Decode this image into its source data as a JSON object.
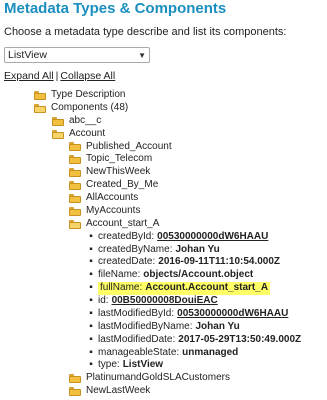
{
  "header": {
    "title": "Metadata Types & Components",
    "prompt": "Choose a metadata type describe and list its components:"
  },
  "select": {
    "value": "ListView"
  },
  "controls": {
    "expand_all": "Expand All",
    "separator": "|",
    "collapse_all": "Collapse All"
  },
  "tree": {
    "type_description": "Type Description",
    "components": "Components (48)",
    "abc": "abc__c",
    "account": "Account",
    "account_children": [
      "Published_Account",
      "Topic_Telecom",
      "NewThisWeek",
      "Created_By_Me",
      "AllAccounts",
      "MyAccounts",
      "Account_start_A"
    ],
    "properties": [
      {
        "label": "createdById:",
        "value": "00530000000dW6HAAU",
        "link": true
      },
      {
        "label": "createdByName:",
        "value": "Johan Yu",
        "link": false
      },
      {
        "label": "createdDate:",
        "value": "2016-09-11T11:10:54.000Z",
        "link": false
      },
      {
        "label": "fileName:",
        "value": "objects/Account.object",
        "link": false
      },
      {
        "label": "fullName:",
        "value": "Account.Account_start_A",
        "link": false,
        "highlight": true
      },
      {
        "label": "id:",
        "value": "00B50000008DouiEAC",
        "link": true
      },
      {
        "label": "lastModifiedById:",
        "value": "00530000000dW6HAAU",
        "link": true
      },
      {
        "label": "lastModifiedByName:",
        "value": "Johan Yu",
        "link": false
      },
      {
        "label": "lastModifiedDate:",
        "value": "2017-05-29T13:50:49.000Z",
        "link": false
      },
      {
        "label": "manageableState:",
        "value": "unmanaged",
        "link": false
      },
      {
        "label": "type:",
        "value": "ListView",
        "link": false
      }
    ],
    "after": [
      "PlatinumandGoldSLACustomers",
      "NewLastWeek"
    ]
  }
}
